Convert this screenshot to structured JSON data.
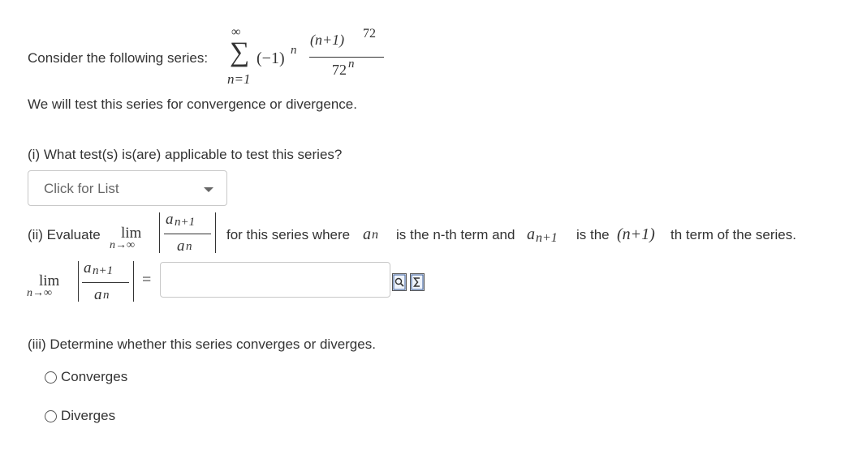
{
  "intro": {
    "lead_text": "Consider the following series:",
    "sum_upper": "∞",
    "sum_lower": "n=1",
    "sigma": "∑",
    "term_base": "(−1)",
    "term_exp": "n",
    "numerator_base": "(n+1)",
    "numerator_exp": "72",
    "denominator_base": "72",
    "denominator_exp": "n"
  },
  "statement": "We will test this series for convergence or divergence.",
  "part1": {
    "question": "(i) What test(s) is(are) applicable to test this series?",
    "dropdown_value": "Click for List"
  },
  "part2": {
    "prefix": "(ii) Evaluate",
    "lim": "lim",
    "lim_sub": "n→∞",
    "frac_num_base": "a",
    "frac_num_sub": "n+1",
    "frac_den_base": "a",
    "frac_den_sub": "n",
    "mid_text": "for this series where",
    "an_base": "a",
    "an_sub": "n",
    "nth_text": "is the n-th term and",
    "an1_base": "a",
    "an1_sub": "n+1",
    "is_the": "is the",
    "n_plus_1": "(n+1)",
    "suffix": "th term of the series.",
    "equals": "=",
    "answer_value": "",
    "preview_icon": "preview-icon",
    "formula_icon": "sigma-icon"
  },
  "part3": {
    "question": "(iii) Determine whether this series converges or diverges.",
    "options": [
      "Converges",
      "Diverges"
    ]
  }
}
